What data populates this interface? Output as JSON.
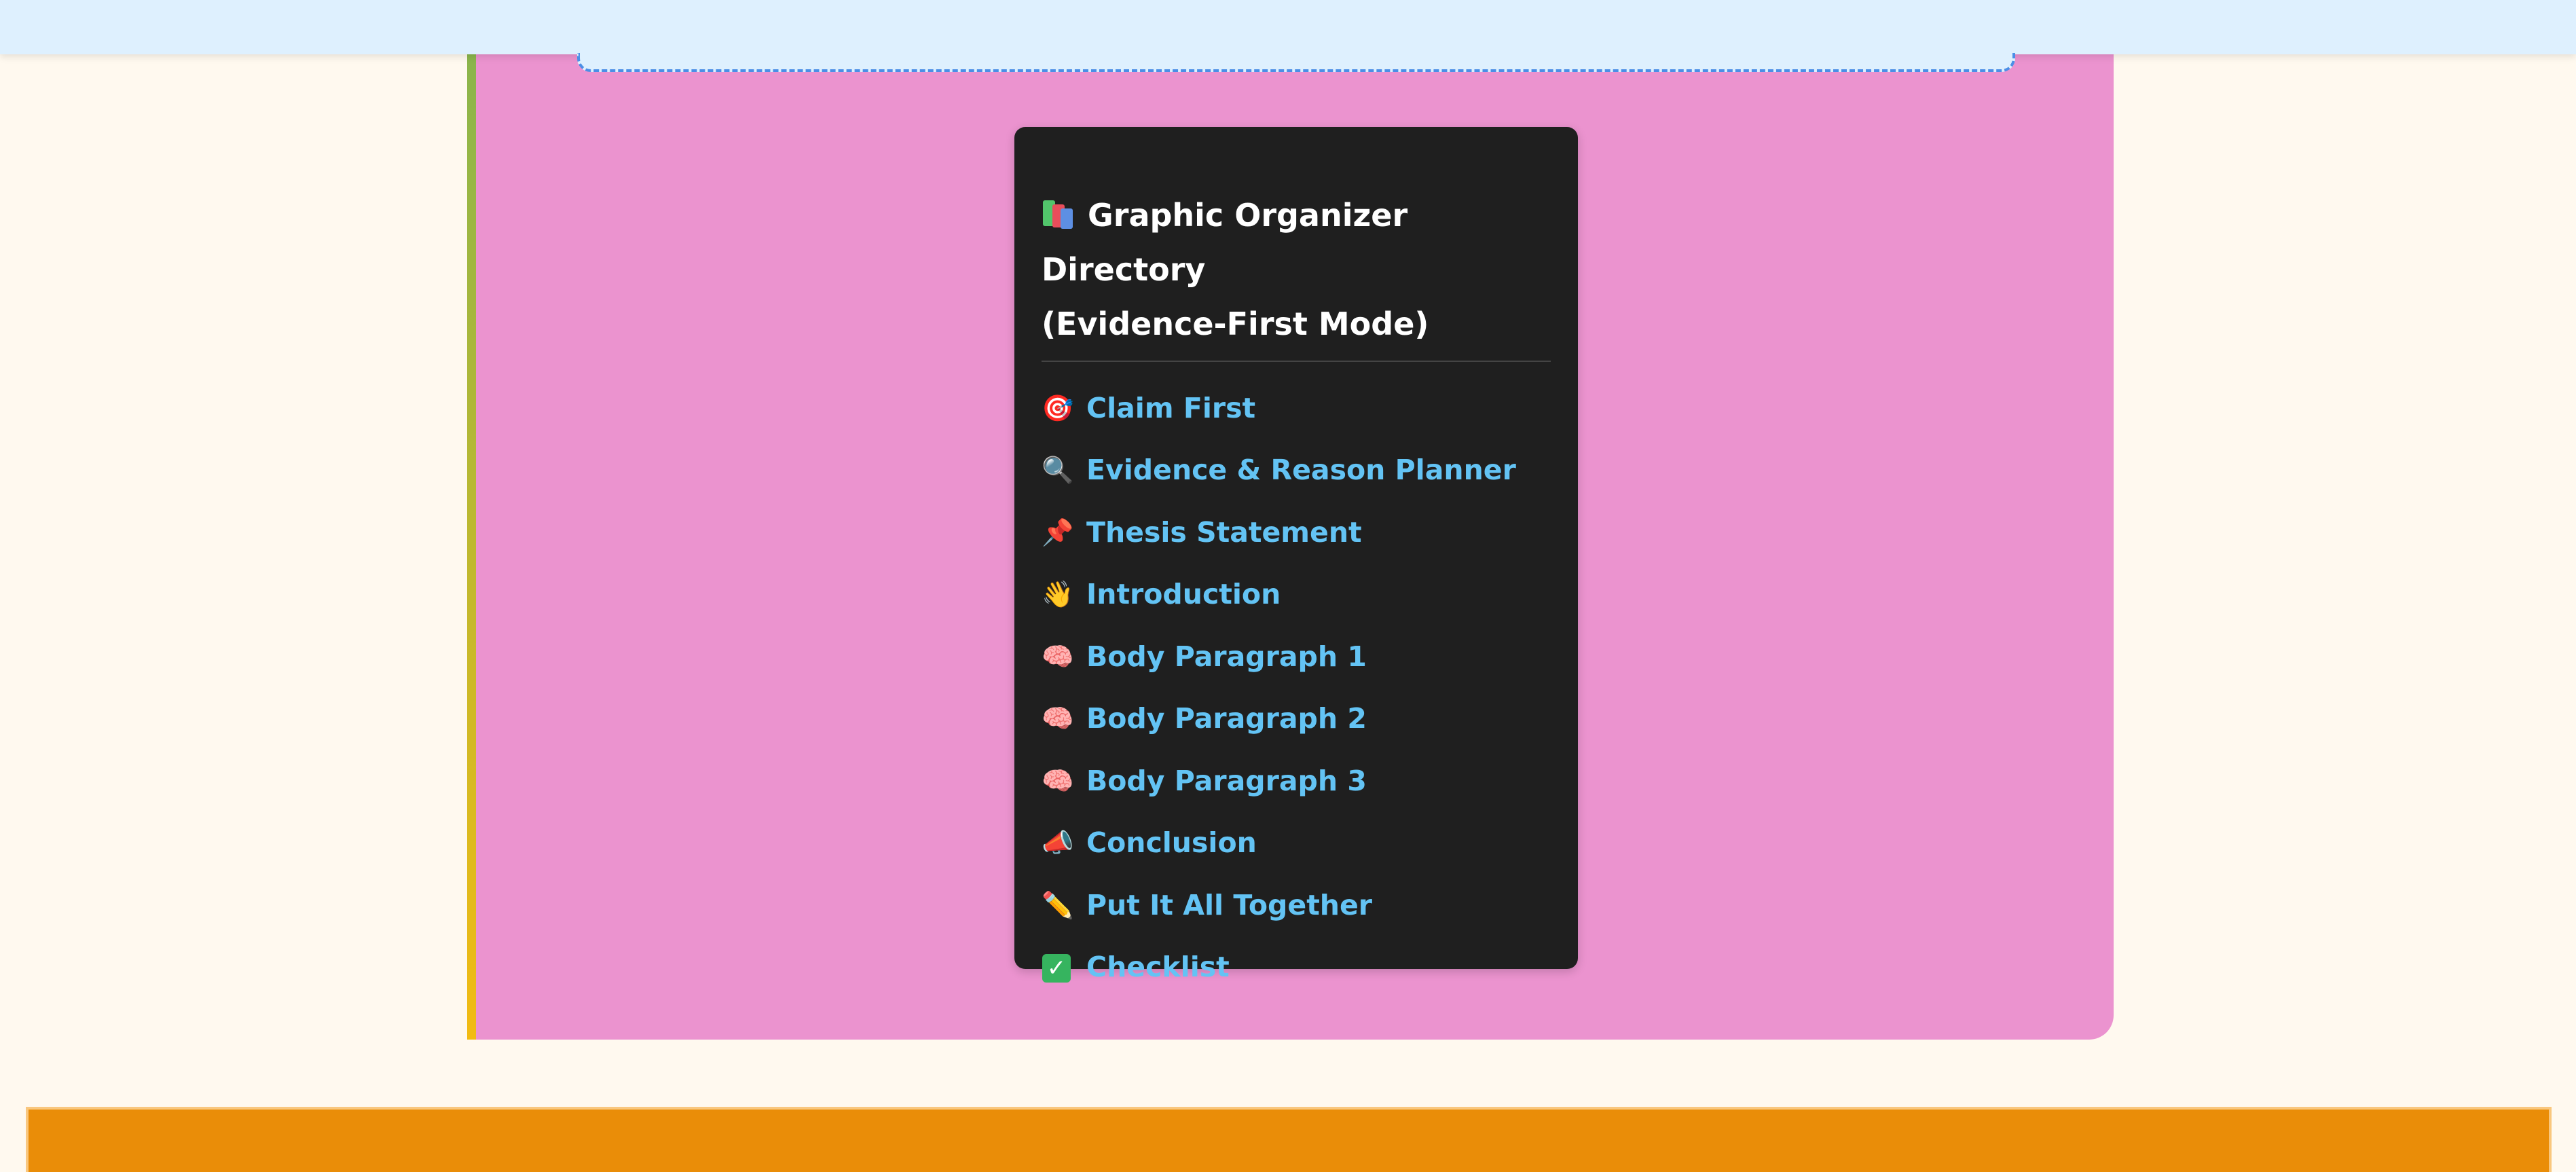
{
  "colors": {
    "page_bg": "#fff9ef",
    "top_bar_bg": "#def0fe",
    "tab_dash": "#4b8fe6",
    "panel_bg": "#eb93cf",
    "panel_stripe_top": "#8bb54c",
    "panel_stripe_bottom": "#f2bb13",
    "card_bg": "#1f1f1f",
    "title_text": "#ffffff",
    "link_text": "#63c3f4",
    "footer_bar": "#ea8d08"
  },
  "directory": {
    "title_icon": "books-icon",
    "title_line1": "Graphic Organizer Directory",
    "title_line2": "(Evidence-First Mode)",
    "items": [
      {
        "icon": "🎯",
        "icon_name": "target-icon",
        "label": "Claim First"
      },
      {
        "icon": "🔍",
        "icon_name": "magnifier-icon",
        "label": "Evidence & Reason Planner"
      },
      {
        "icon": "📌",
        "icon_name": "pushpin-icon",
        "label": "Thesis Statement"
      },
      {
        "icon": "👋",
        "icon_name": "waving-hand-icon",
        "label": "Introduction"
      },
      {
        "icon": "🧠",
        "icon_name": "brain-icon",
        "label": "Body Paragraph 1"
      },
      {
        "icon": "🧠",
        "icon_name": "brain-icon",
        "label": "Body Paragraph 2"
      },
      {
        "icon": "🧠",
        "icon_name": "brain-icon",
        "label": "Body Paragraph 3"
      },
      {
        "icon": "📣",
        "icon_name": "megaphone-icon",
        "label": "Conclusion"
      },
      {
        "icon": "✏️",
        "icon_name": "pencil-icon",
        "label": "Put It All Together"
      },
      {
        "icon": "✓",
        "icon_name": "checkmark-icon",
        "label": "Checklist"
      }
    ]
  }
}
